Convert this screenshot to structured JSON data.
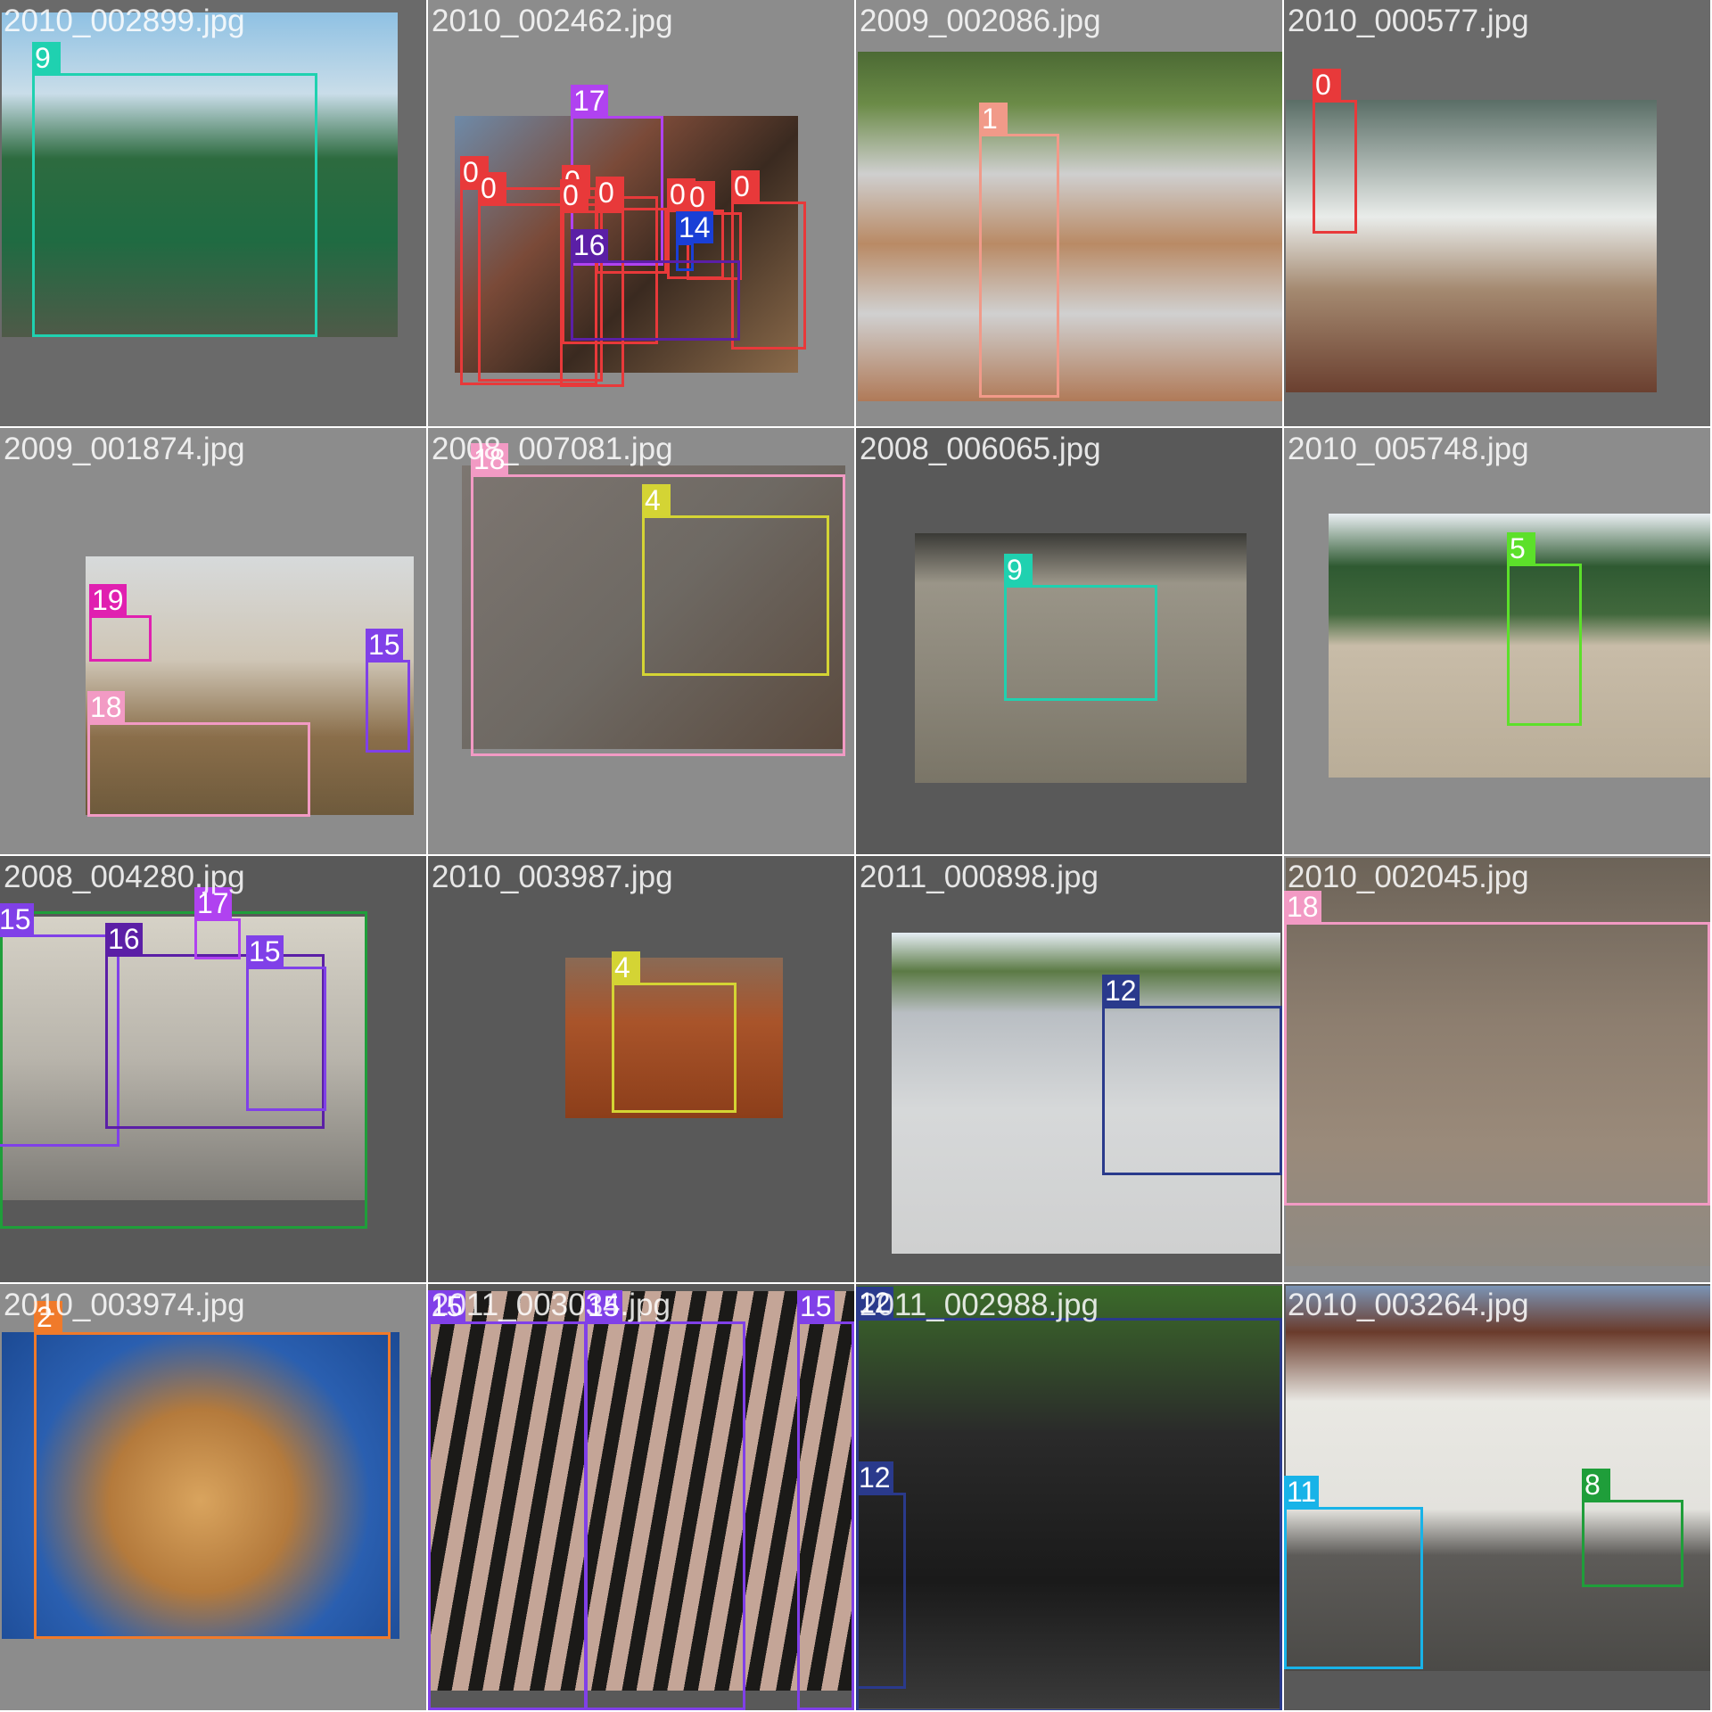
{
  "tiles": [
    {
      "filename": "2010_002899.jpg",
      "bg": "#6a6a6a",
      "photo": {
        "bg": "linear-gradient(180deg,#8fc1e3 0%,#c9dde9 25%,#2d6b3f 45%,#1f6b42 70%,#4f5a48 100%)"
      },
      "boxes": [
        {
          "label": "9",
          "color": "#1fd1b0"
        }
      ]
    },
    {
      "filename": "2010_002462.jpg",
      "bg": "#8c8c8c",
      "photo": {
        "bg": "linear-gradient(135deg,#6e8aa8 0%,#7a4a38 35%,#3a2a20 60%,#8a6a4a 100%)"
      },
      "boxes": [
        {
          "label": "17",
          "color": "#b042f0"
        },
        {
          "label": "0",
          "color": "#e8393a"
        },
        {
          "label": "0",
          "color": "#e8393a"
        },
        {
          "label": "0",
          "color": "#e8393a"
        },
        {
          "label": "0",
          "color": "#e8393a"
        },
        {
          "label": "0",
          "color": "#e8393a"
        },
        {
          "label": "0",
          "color": "#e8393a"
        },
        {
          "label": "0",
          "color": "#e8393a"
        },
        {
          "label": "0",
          "color": "#e8393a"
        },
        {
          "label": "14",
          "color": "#1a3fd6"
        },
        {
          "label": "16",
          "color": "#5b1fa6"
        }
      ]
    },
    {
      "filename": "2009_002086.jpg",
      "bg": "#8c8c8c",
      "photo": {
        "bg": "linear-gradient(180deg,#4c6a34 0%,#6b8b47 15%,#cfcfcf 35%,#b98a65 55%,#d0d0d0 75%,#b07a58 100%)"
      },
      "boxes": [
        {
          "label": "1",
          "color": "#f19a89"
        }
      ]
    },
    {
      "filename": "2010_000577.jpg",
      "bg": "#6a6a6a",
      "photo": {
        "bg": "linear-gradient(180deg,#5a6e66 0%,#e9ecea 40%,#a48970 65%,#6b4030 100%)"
      },
      "boxes": [
        {
          "label": "0",
          "color": "#e8393a"
        }
      ]
    },
    {
      "filename": "2009_001874.jpg",
      "bg": "#8c8c8c",
      "photo": {
        "bg": "linear-gradient(180deg,#d7dadb 0%,#cfc6b6 40%,#8a6e4a 70%,#6e5a3c 100%)"
      },
      "boxes": [
        {
          "label": "19",
          "color": "#e020b0"
        },
        {
          "label": "15",
          "color": "#8040e8"
        },
        {
          "label": "18",
          "color": "#f29ac4"
        }
      ]
    },
    {
      "filename": "2008_007081.jpg",
      "bg": "#8c8c8c",
      "photo": {
        "bg": "linear-gradient(135deg,#7d7671 0%,#6e6963 50%,#5a4a3e 100%)"
      },
      "boxes": [
        {
          "label": "18",
          "color": "#f29ac4"
        },
        {
          "label": "4",
          "color": "#d4d434"
        }
      ]
    },
    {
      "filename": "2008_006065.jpg",
      "bg": "#595959",
      "photo": {
        "bg": "linear-gradient(180deg,#3a3a36 0%,#9a9588 20%,#8b8679 60%,#7a7567 100%)"
      },
      "boxes": [
        {
          "label": "9",
          "color": "#1fd1b0"
        }
      ]
    },
    {
      "filename": "2010_005748.jpg",
      "bg": "#8c8c8c",
      "photo": {
        "bg": "linear-gradient(180deg,#e9eef2 0%,#2f5a32 20%,#41683c 38%,#c8bca8 50%,#b9ad98 100%)"
      },
      "boxes": [
        {
          "label": "5",
          "color": "#5ce02a"
        }
      ]
    },
    {
      "filename": "2008_004280.jpg",
      "bg": "#595959",
      "photo": {
        "bg": "linear-gradient(180deg,#d6d2c7 0%,#b8b4ab 50%,#7d7b76 100%)"
      },
      "boxes": [
        {
          "label": "",
          "color": "#1f9e3a"
        },
        {
          "label": "15",
          "color": "#8040e8"
        },
        {
          "label": "16",
          "color": "#5b1fa6"
        },
        {
          "label": "17",
          "color": "#b042f0"
        },
        {
          "label": "15",
          "color": "#8040e8"
        }
      ]
    },
    {
      "filename": "2010_003987.jpg",
      "bg": "#595959",
      "photo": {
        "bg": "linear-gradient(180deg,#8a6a55 0%,#a9542a 40%,#8c3e1a 100%)"
      },
      "boxes": [
        {
          "label": "4",
          "color": "#d4d434"
        }
      ]
    },
    {
      "filename": "2011_000898.jpg",
      "bg": "#595959",
      "photo": {
        "bg": "linear-gradient(180deg,#e6eef5 0%,#5b7a45 12%,#b9bec3 25%,#d6d8d9 55%,#cfd0d0 100%)"
      },
      "boxes": [
        {
          "label": "12",
          "color": "#2a3a8c"
        }
      ]
    },
    {
      "filename": "2010_002045.jpg",
      "bg": "#8c8c8c",
      "photo": {
        "bg": "linear-gradient(180deg,#6c6358 0%,#8d7e6f 40%,#9a8a7a 70%,#8f8a83 100%)"
      },
      "boxes": [
        {
          "label": "18",
          "color": "#f29ac4"
        }
      ]
    },
    {
      "filename": "2010_003974.jpg",
      "bg": "#8c8c8c",
      "photo": {
        "bg": "radial-gradient(circle at 50% 55%,#d9a45e 0%,#b47a3c 35%,#2a5fb0 65%,#1c4a94 100%)"
      },
      "boxes": [
        {
          "label": "2",
          "color": "#f07a2a"
        }
      ]
    },
    {
      "filename": "2011_003034.jpg",
      "bg": "#595959",
      "photo": {
        "bg": "repeating-linear-gradient(100deg,#c4a597 0 18px,#1b1a18 18px 34px)"
      },
      "boxes": [
        {
          "label": "15",
          "color": "#8040e8"
        },
        {
          "label": "15",
          "color": "#8040e8"
        },
        {
          "label": "15",
          "color": "#8040e8"
        }
      ]
    },
    {
      "filename": "2011_002988.jpg",
      "bg": "#595959",
      "photo": {
        "bg": "linear-gradient(180deg,#3b6a2a 0%,#2a2a2a 35%,#1a1a1a 70%,#3a3a3a 100%)"
      },
      "boxes": [
        {
          "label": "12",
          "color": "#2a3a8c"
        },
        {
          "label": "12",
          "color": "#2a3a8c"
        }
      ]
    },
    {
      "filename": "2010_003264.jpg",
      "bg": "#595959",
      "photo": {
        "bg": "linear-gradient(180deg,#7b94b5 0%,#6a3b2b 12%,#e9e8e3 30%,#e3e2dd 58%,#5d5b58 70%,#4b4a47 100%)"
      },
      "boxes": [
        {
          "label": "11",
          "color": "#18b3e8"
        },
        {
          "label": "8",
          "color": "#1f9e3a"
        }
      ]
    }
  ]
}
